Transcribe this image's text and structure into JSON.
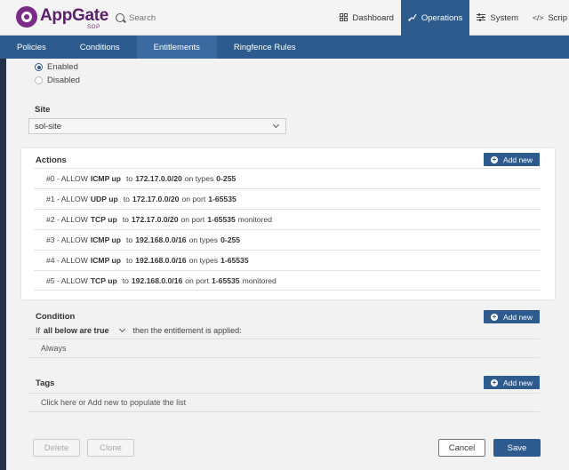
{
  "header": {
    "logo_text": "AppGate",
    "logo_sub": "SDP",
    "search_placeholder": "Search",
    "nav": [
      {
        "label": "Dashboard",
        "icon": "grid-icon"
      },
      {
        "label": "Operations",
        "icon": "operations-icon",
        "active": true
      },
      {
        "label": "System",
        "icon": "sliders-icon"
      },
      {
        "label": "Scrip",
        "icon": "code-icon"
      }
    ]
  },
  "subnav": {
    "tabs": [
      {
        "label": "Policies"
      },
      {
        "label": "Conditions"
      },
      {
        "label": "Entitlements",
        "active": true
      },
      {
        "label": "Ringfence Rules"
      }
    ]
  },
  "status": {
    "enabled_label": "Enabled",
    "disabled_label": "Disabled",
    "selected": "Enabled"
  },
  "site": {
    "label": "Site",
    "value": "sol-site"
  },
  "actions": {
    "title": "Actions",
    "add_label": "Add new",
    "rows": [
      {
        "index": "#0 - ALLOW",
        "proto": "ICMP up",
        "to": "to",
        "subnet": "172.17.0.0/20",
        "on": "on types",
        "range": "0-255",
        "extra": ""
      },
      {
        "index": "#1 - ALLOW",
        "proto": "UDP up",
        "to": "to",
        "subnet": "172.17.0.0/20",
        "on": "on port",
        "range": "1-65535",
        "extra": ""
      },
      {
        "index": "#2 - ALLOW",
        "proto": "TCP up",
        "to": "to",
        "subnet": "172.17.0.0/20",
        "on": "on port",
        "range": "1-65535",
        "extra": "monitored"
      },
      {
        "index": "#3 - ALLOW",
        "proto": "ICMP up",
        "to": "to",
        "subnet": "192.168.0.0/16",
        "on": "on types",
        "range": "0-255",
        "extra": ""
      },
      {
        "index": "#4 - ALLOW",
        "proto": "ICMP up",
        "to": "to",
        "subnet": "192.168.0.0/16",
        "on": "on types",
        "range": "1-65535",
        "extra": ""
      },
      {
        "index": "#5 - ALLOW",
        "proto": "TCP up",
        "to": "to",
        "subnet": "192.168.0.0/16",
        "on": "on port",
        "range": "1-65535",
        "extra": "monitored"
      }
    ]
  },
  "condition": {
    "title": "Condition",
    "add_label": "Add new",
    "prefix": "If",
    "mode": "all below are true",
    "suffix": "then the entitlement is applied:",
    "value": "Always"
  },
  "tags": {
    "title": "Tags",
    "add_label": "Add new",
    "placeholder": "Click here or Add new to populate the list"
  },
  "footer": {
    "delete_label": "Delete",
    "clone_label": "Clone",
    "cancel_label": "Cancel",
    "save_label": "Save"
  }
}
